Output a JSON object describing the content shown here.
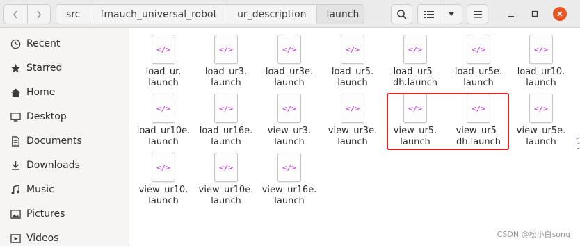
{
  "breadcrumbs": [
    "src",
    "fmauch_universal_robot",
    "ur_description",
    "launch"
  ],
  "sidebar": {
    "items": [
      {
        "label": "Recent",
        "icon": "clock-icon"
      },
      {
        "label": "Starred",
        "icon": "star-icon"
      },
      {
        "label": "Home",
        "icon": "home-icon"
      },
      {
        "label": "Desktop",
        "icon": "desktop-icon"
      },
      {
        "label": "Documents",
        "icon": "document-icon"
      },
      {
        "label": "Downloads",
        "icon": "download-icon"
      },
      {
        "label": "Music",
        "icon": "music-icon"
      },
      {
        "label": "Pictures",
        "icon": "pictures-icon"
      },
      {
        "label": "Videos",
        "icon": "video-icon"
      }
    ]
  },
  "files": [
    {
      "line1": "load_ur.",
      "line2": "launch"
    },
    {
      "line1": "load_ur3.",
      "line2": "launch"
    },
    {
      "line1": "load_ur3e.",
      "line2": "launch"
    },
    {
      "line1": "load_ur5.",
      "line2": "launch"
    },
    {
      "line1": "load_ur5_",
      "line2": "dh.launch"
    },
    {
      "line1": "load_ur5e.",
      "line2": "launch"
    },
    {
      "line1": "load_ur10.",
      "line2": "launch"
    },
    {
      "line1": "load_ur10e.",
      "line2": "launch"
    },
    {
      "line1": "load_ur16e.",
      "line2": "launch"
    },
    {
      "line1": "view_ur3.",
      "line2": "launch"
    },
    {
      "line1": "view_ur3e.",
      "line2": "launch"
    },
    {
      "line1": "view_ur5.",
      "line2": "launch"
    },
    {
      "line1": "view_ur5_",
      "line2": "dh.launch"
    },
    {
      "line1": "view_ur5e.",
      "line2": "launch"
    },
    {
      "line1": "view_ur10.",
      "line2": "launch"
    },
    {
      "line1": "view_ur10e.",
      "line2": "launch"
    },
    {
      "line1": "view_ur16e.",
      "line2": "launch"
    }
  ],
  "file_icon_text": "</>",
  "watermark": "CSDN @松小白song",
  "colors": {
    "accent_close": "#e95420",
    "highlight": "#e02424",
    "file_icon": "#c34bd6"
  }
}
